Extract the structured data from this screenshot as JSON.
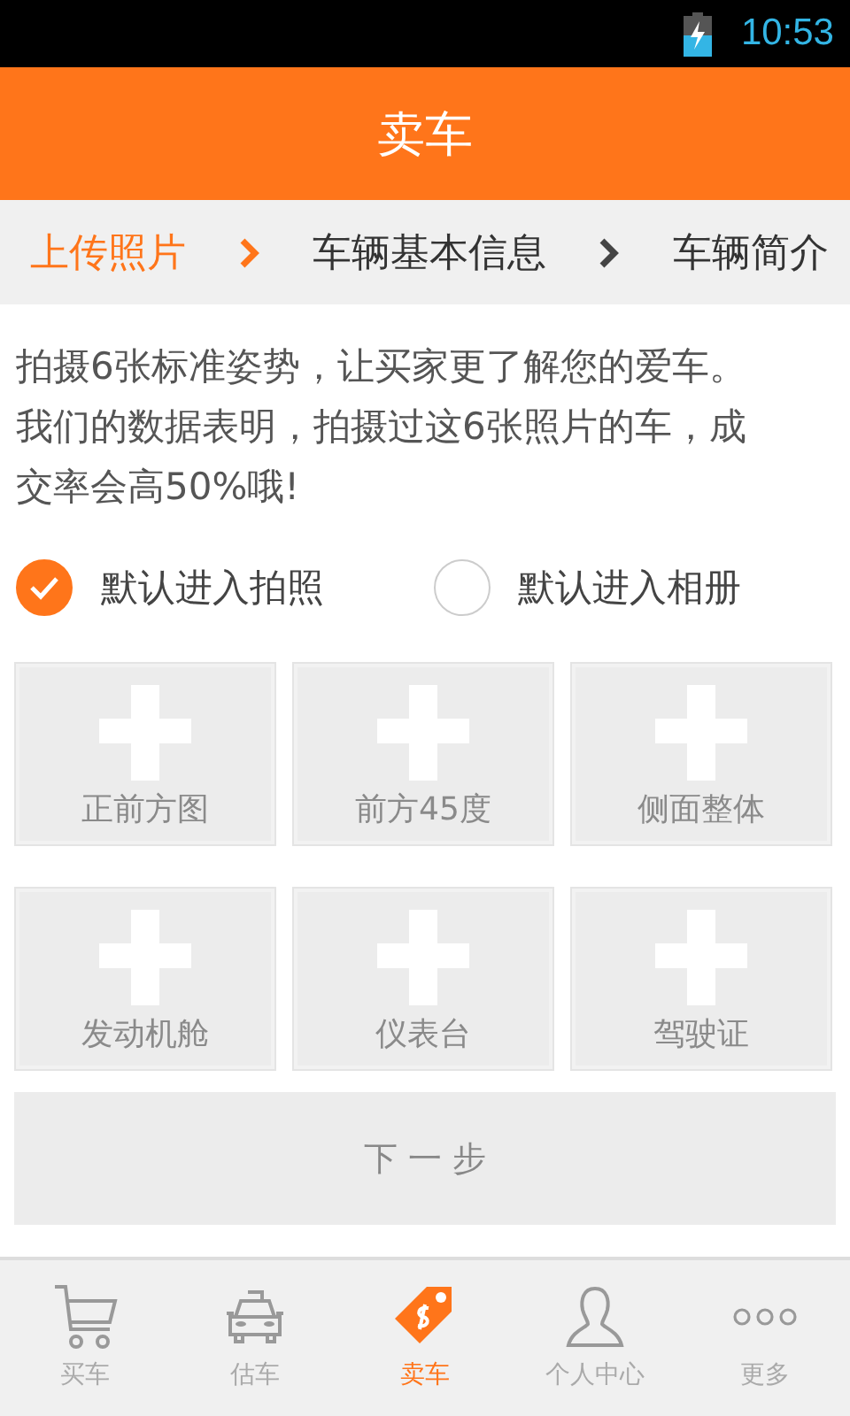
{
  "status_bar": {
    "time": "10:53"
  },
  "header": {
    "title": "卖车"
  },
  "steps": [
    {
      "label": "上传照片",
      "selected": true
    },
    {
      "label": "车辆基本信息",
      "selected": false
    },
    {
      "label": "车辆简介",
      "selected": false
    }
  ],
  "intro": "拍摄6张标准姿势，让买家更了解您的爱车。我们的数据表明，拍摄过这6张照片的车，成交率会高50%哦!",
  "options": [
    {
      "label": "默认进入拍照",
      "selected": true
    },
    {
      "label": "默认进入相册",
      "selected": false
    }
  ],
  "photo_slots": [
    {
      "label": "正前方图"
    },
    {
      "label": "前方45度"
    },
    {
      "label": "侧面整体"
    },
    {
      "label": "发动机舱"
    },
    {
      "label": "仪表台"
    },
    {
      "label": "驾驶证"
    }
  ],
  "next_button": {
    "label": "下 一 步"
  },
  "tab_bar": [
    {
      "kind": "cart",
      "label": "买车",
      "selected": false
    },
    {
      "kind": "taxi",
      "label": "估车",
      "selected": false
    },
    {
      "kind": "tag",
      "label": "卖车",
      "selected": true
    },
    {
      "kind": "person",
      "label": "个人中心",
      "selected": false
    },
    {
      "kind": "more",
      "label": "更多",
      "selected": false
    }
  ]
}
